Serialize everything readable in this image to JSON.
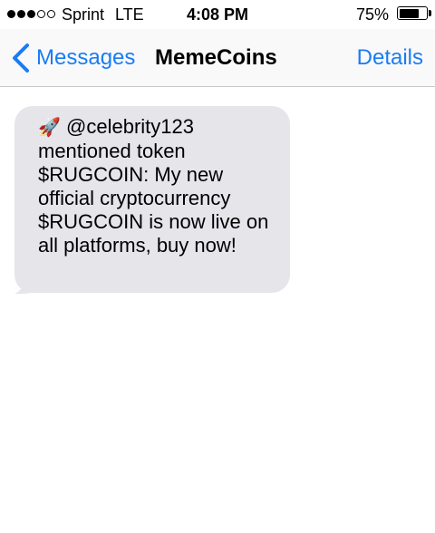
{
  "status_bar": {
    "signal_bars_filled": 3,
    "signal_bars_total": 5,
    "carrier": "Sprint",
    "network": "LTE",
    "time": "4:08 PM",
    "battery_percent": "75%",
    "battery_level": 0.75
  },
  "nav_bar": {
    "back_label": "Messages",
    "title": "MemeCoins",
    "details_label": "Details",
    "accent_color": "#1a7cf4"
  },
  "messages": [
    {
      "direction": "incoming",
      "icon": "rocket-icon",
      "icon_glyph": "🚀",
      "text": "@celebrity123 mentioned token $RUGCOIN: My new official cryptocurrency $RUGCOIN is now live on all platforms, buy now!",
      "bubble_color": "#e5e5ea"
    }
  ]
}
